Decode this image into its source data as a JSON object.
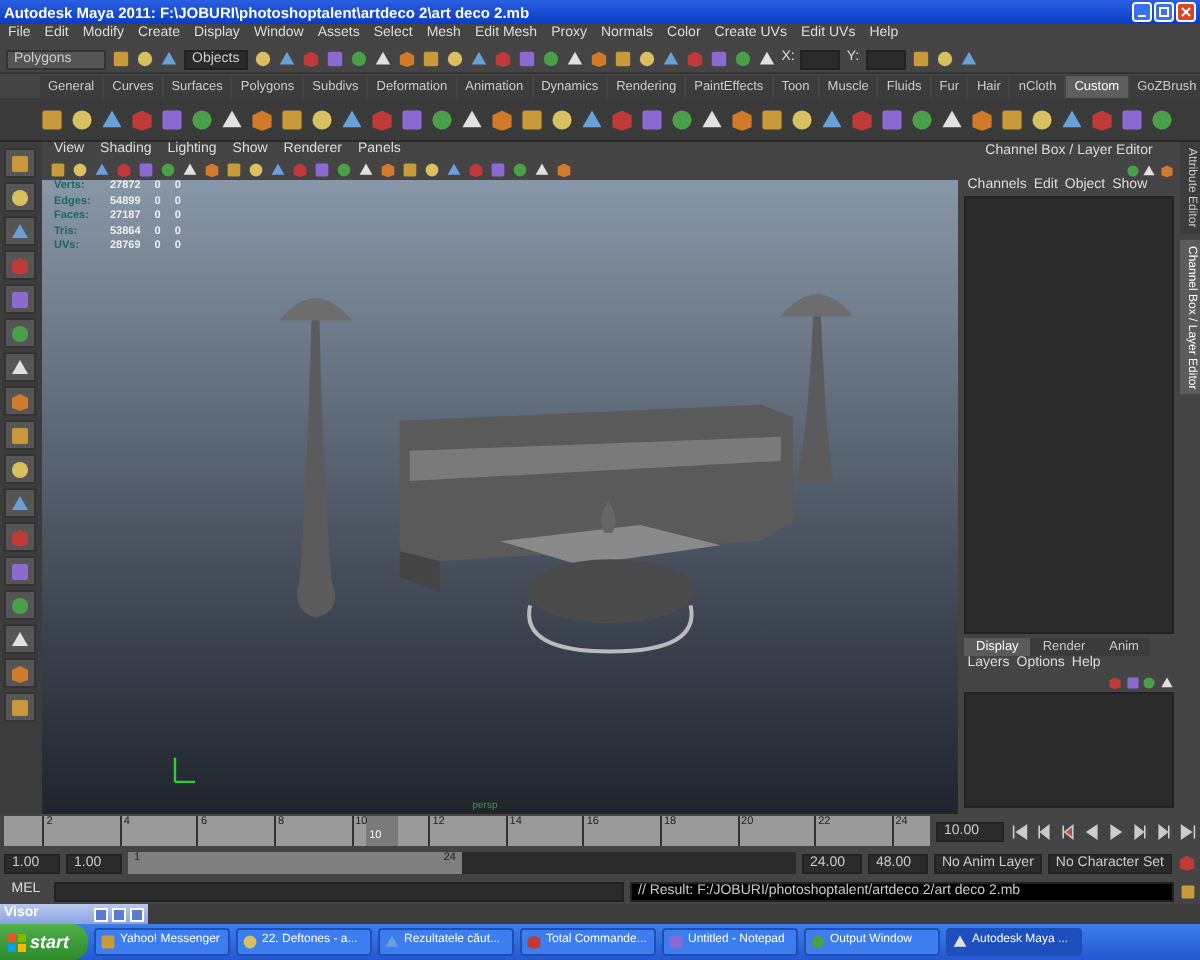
{
  "window": {
    "title": "Autodesk Maya 2011: F:\\JOBURI\\photoshoptalent\\artdeco 2\\art deco 2.mb"
  },
  "menu": [
    "File",
    "Edit",
    "Modify",
    "Create",
    "Display",
    "Window",
    "Assets",
    "Select",
    "Mesh",
    "Edit Mesh",
    "Proxy",
    "Normals",
    "Color",
    "Create UVs",
    "Edit UVs",
    "Help"
  ],
  "status_line": {
    "mode": "Polygons",
    "selection_field": "Objects",
    "x_label": "X:",
    "y_label": "Y:"
  },
  "shelf_tabs": [
    {
      "label": "General",
      "selected": false
    },
    {
      "label": "Curves",
      "selected": false
    },
    {
      "label": "Surfaces",
      "selected": false
    },
    {
      "label": "Polygons",
      "selected": false
    },
    {
      "label": "Subdivs",
      "selected": false
    },
    {
      "label": "Deformation",
      "selected": false
    },
    {
      "label": "Animation",
      "selected": false
    },
    {
      "label": "Dynamics",
      "selected": false
    },
    {
      "label": "Rendering",
      "selected": false
    },
    {
      "label": "PaintEffects",
      "selected": false
    },
    {
      "label": "Toon",
      "selected": false
    },
    {
      "label": "Muscle",
      "selected": false
    },
    {
      "label": "Fluids",
      "selected": false
    },
    {
      "label": "Fur",
      "selected": false
    },
    {
      "label": "Hair",
      "selected": false
    },
    {
      "label": "nCloth",
      "selected": false
    },
    {
      "label": "Custom",
      "selected": true
    },
    {
      "label": "GoZBrush",
      "selected": false
    }
  ],
  "viewport": {
    "menu": [
      "View",
      "Shading",
      "Lighting",
      "Show",
      "Renderer",
      "Panels"
    ],
    "stats": [
      {
        "label": "Verts:",
        "values": [
          "27872",
          "0",
          "0"
        ]
      },
      {
        "label": "Edges:",
        "values": [
          "54899",
          "0",
          "0"
        ]
      },
      {
        "label": "Faces:",
        "values": [
          "27187",
          "0",
          "0"
        ]
      },
      {
        "label": "Tris:",
        "values": [
          "53864",
          "0",
          "0"
        ]
      },
      {
        "label": "UVs:",
        "values": [
          "28769",
          "0",
          "0"
        ]
      }
    ],
    "camera_label": "persp"
  },
  "channel_box": {
    "title": "Channel Box / Layer Editor",
    "menu": [
      "Channels",
      "Edit",
      "Object",
      "Show"
    ],
    "layer_tabs": [
      {
        "label": "Display",
        "selected": true
      },
      {
        "label": "Render",
        "selected": false
      },
      {
        "label": "Anim",
        "selected": false
      }
    ],
    "layer_menu": [
      "Layers",
      "Options",
      "Help"
    ]
  },
  "side_tabs": [
    {
      "label": "Attribute Editor",
      "selected": false
    },
    {
      "label": "Channel Box / Layer Editor",
      "selected": true
    }
  ],
  "time_slider": {
    "ticks": [
      "2",
      "4",
      "6",
      "8",
      "10",
      "12",
      "14",
      "16",
      "18",
      "20",
      "22",
      "24"
    ],
    "current": "10",
    "level": 0.39,
    "current_time": "10.00"
  },
  "range_slider": {
    "start": "1.00",
    "range_start": "1.00",
    "handle_start": "1",
    "handle_end": "24",
    "level": 0.5,
    "range_end": "24.00",
    "end": "48.00",
    "anim_layer": "No Anim Layer",
    "character_set": "No Character Set"
  },
  "command_line": {
    "label": "MEL",
    "result": "// Result: F:/JOBURI/photoshoptalent/artdeco 2/art deco 2.mb"
  },
  "visor": {
    "title": "Visor"
  },
  "taskbar": {
    "start": "start",
    "items": [
      {
        "label": "Yahoo! Messenger",
        "selected": false
      },
      {
        "label": "22. Deftones - a...",
        "selected": false
      },
      {
        "label": "Rezultatele căut...",
        "selected": false
      },
      {
        "label": "Total Commande...",
        "selected": false
      },
      {
        "label": "Untitled - Notepad",
        "selected": false
      },
      {
        "label": "Output Window",
        "selected": false
      },
      {
        "label": "Autodesk Maya ...",
        "selected": true
      }
    ]
  }
}
